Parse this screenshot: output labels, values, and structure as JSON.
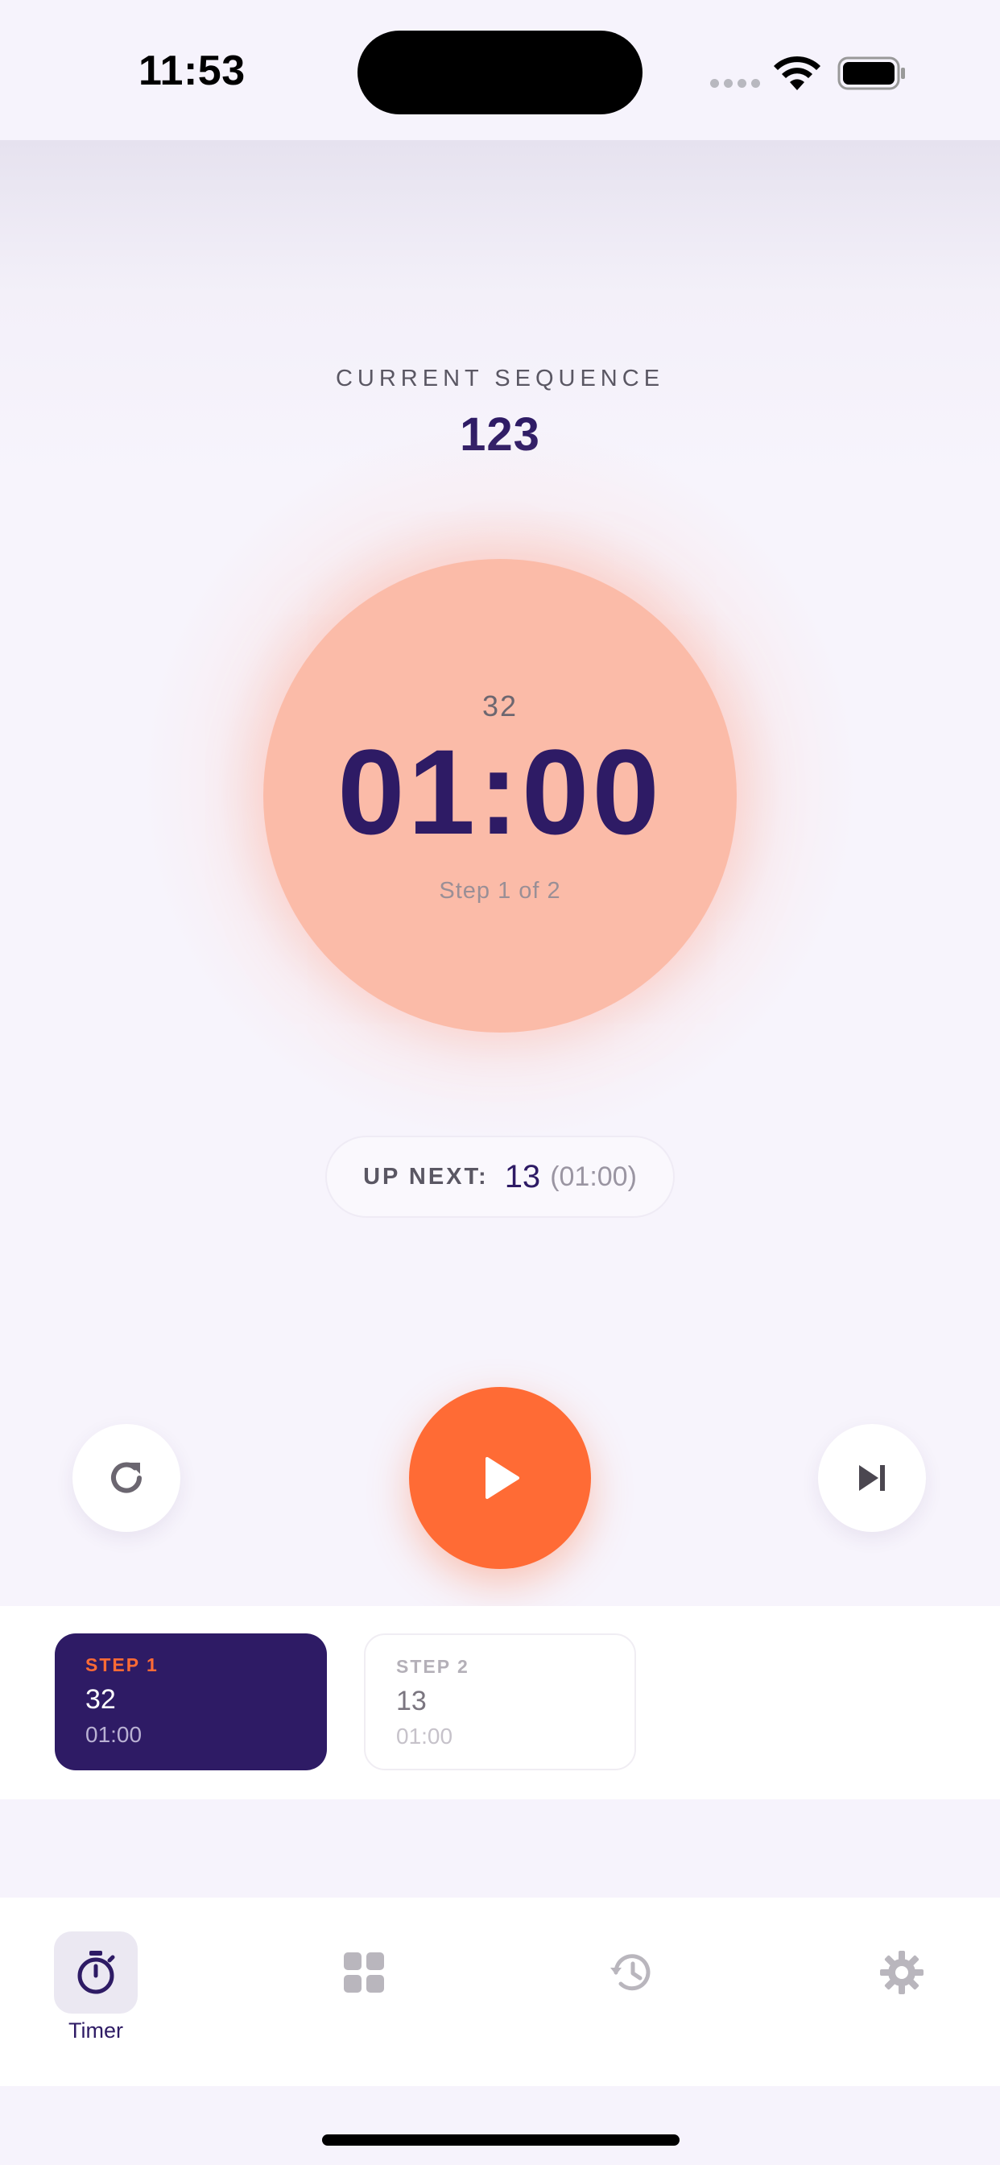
{
  "status_bar": {
    "time": "11:53"
  },
  "sequence": {
    "label": "CURRENT SEQUENCE",
    "name": "123"
  },
  "timer": {
    "step_value": "32",
    "time": "01:00",
    "step_count": "Step 1 of 2"
  },
  "up_next": {
    "label": "UP NEXT:",
    "value": "13",
    "duration": "(01:00)"
  },
  "controls": {
    "reset_icon": "reset-icon",
    "play_icon": "play-icon",
    "skip_icon": "skip-next-icon"
  },
  "steps": [
    {
      "label": "STEP 1",
      "value": "32",
      "time": "01:00",
      "active": true
    },
    {
      "label": "STEP 2",
      "value": "13",
      "time": "01:00",
      "active": false
    }
  ],
  "tabs": [
    {
      "label": "Timer",
      "icon": "stopwatch-icon",
      "active": true
    },
    {
      "label": "",
      "icon": "grid-icon",
      "active": false
    },
    {
      "label": "",
      "icon": "history-icon",
      "active": false
    },
    {
      "label": "",
      "icon": "gear-icon",
      "active": false
    }
  ],
  "colors": {
    "accent": "#ff6b35",
    "primary": "#2e1b65",
    "timer_circle": "#fbbba8",
    "background": "#f6f3fc"
  }
}
